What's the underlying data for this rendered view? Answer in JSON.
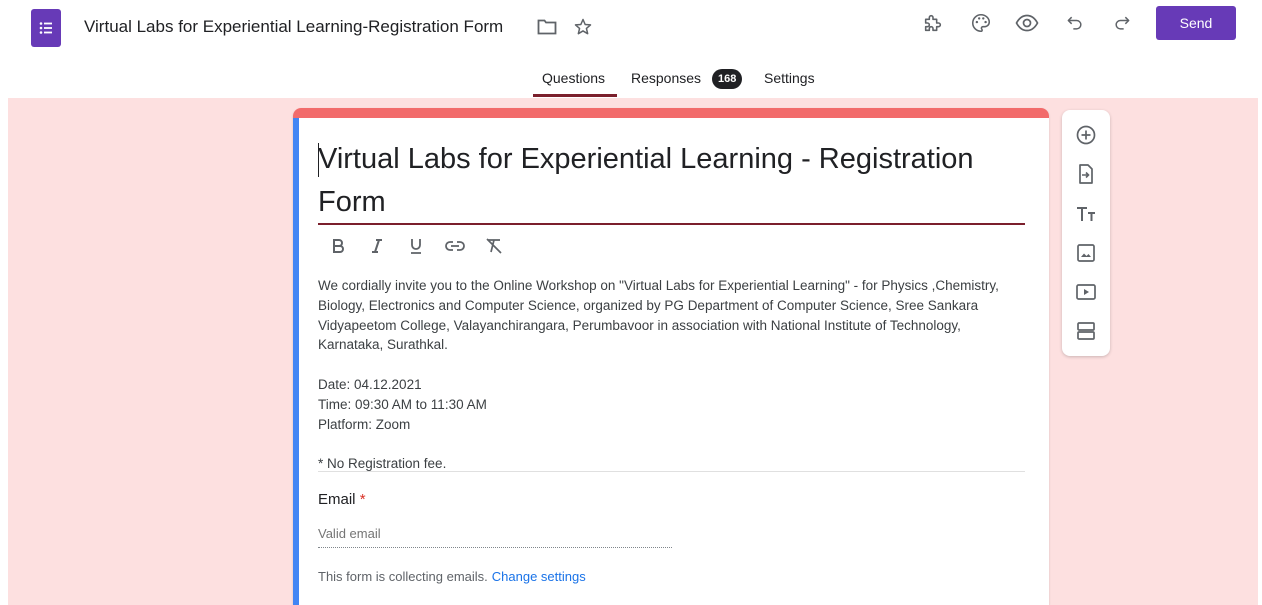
{
  "header": {
    "title": "Virtual Labs for Experiential Learning-Registration Form",
    "send_label": "Send",
    "icons": [
      "forms-app-icon",
      "folder-icon",
      "star-icon",
      "addon-icon",
      "palette-icon",
      "preview-eye-icon",
      "undo-icon",
      "redo-icon"
    ]
  },
  "tabs": {
    "questions": "Questions",
    "responses": "Responses",
    "responses_count": "168",
    "settings": "Settings"
  },
  "form": {
    "title": "Virtual Labs for Experiential Learning - Registration Form",
    "description": "We cordially invite you to the Online Workshop on \"Virtual Labs for Experiential Learning\" - for Physics ,Chemistry, Biology, Electronics and Computer Science, organized by PG Department of Computer Science, Sree Sankara Vidyapeetom College, Valayanchirangara, Perumbavoor in association with National Institute of Technology, Karnataka, Surathkal.\n\nDate: 04.12.2021\nTime: 09:30 AM to 11:30 AM\nPlatform: Zoom\n\n* No Registration fee.",
    "format_icons": [
      "bold-icon",
      "italic-icon",
      "underline-icon",
      "link-icon",
      "clear-format-icon"
    ]
  },
  "email_question": {
    "label": "Email",
    "required_mark": "*",
    "placeholder": "Valid email",
    "note": "This form is collecting emails.",
    "change_link": "Change settings"
  },
  "float_toolbar": {
    "icons": [
      "add-question-icon",
      "import-questions-icon",
      "add-title-icon",
      "add-image-icon",
      "add-video-icon",
      "add-section-icon"
    ]
  },
  "colors": {
    "accent": "#673ab7",
    "theme": "#f26b6b",
    "background": "#fde0e0",
    "active_border": "#4285f4",
    "link": "#1a73e8"
  }
}
